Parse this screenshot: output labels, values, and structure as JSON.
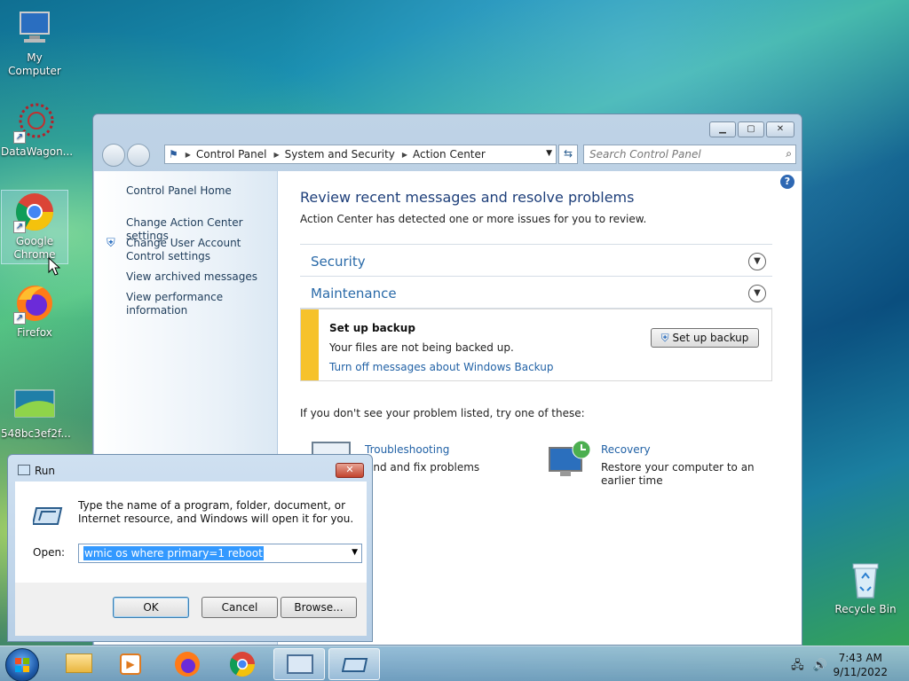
{
  "desktop": {
    "icons": [
      {
        "label": "My Computer"
      },
      {
        "label": "DataWagon..."
      },
      {
        "label": "Google Chrome"
      },
      {
        "label": "Firefox"
      },
      {
        "label": "548bc3ef2f..."
      },
      {
        "label": "Recycle Bin"
      }
    ]
  },
  "control_panel": {
    "breadcrumbs": [
      "Control Panel",
      "System and Security",
      "Action Center"
    ],
    "search_placeholder": "Search Control Panel",
    "left_links": [
      "Control Panel Home",
      "Change Action Center settings",
      "Change User Account Control settings",
      "View archived messages",
      "View performance information"
    ],
    "title": "Review recent messages and resolve problems",
    "subtitle": "Action Center has detected one or more issues for you to review.",
    "sections": {
      "security": "Security",
      "maintenance": "Maintenance"
    },
    "message": {
      "heading": "Set up backup",
      "text": "Your files are not being backed up.",
      "link": "Turn off messages about Windows Backup",
      "button": "Set up backup"
    },
    "alt_prompt": "If you don't see your problem listed, try one of these:",
    "troubleshooting": {
      "title": "Troubleshooting",
      "desc": "Find and fix problems"
    },
    "recovery": {
      "title": "Recovery",
      "desc1": "Restore your computer to an",
      "desc2": "earlier time"
    }
  },
  "run_dialog": {
    "title": "Run",
    "description": "Type the name of a program, folder, document, or Internet resource, and Windows will open it for you.",
    "open_label": "Open:",
    "open_value": "wmic os where primary=1 reboot",
    "ok": "OK",
    "cancel": "Cancel",
    "browse": "Browse..."
  },
  "taskbar": {
    "time": "7:43 AM",
    "date": "9/11/2022"
  },
  "colors": {
    "accent": "#2262a6",
    "warning": "#f6c22b"
  }
}
